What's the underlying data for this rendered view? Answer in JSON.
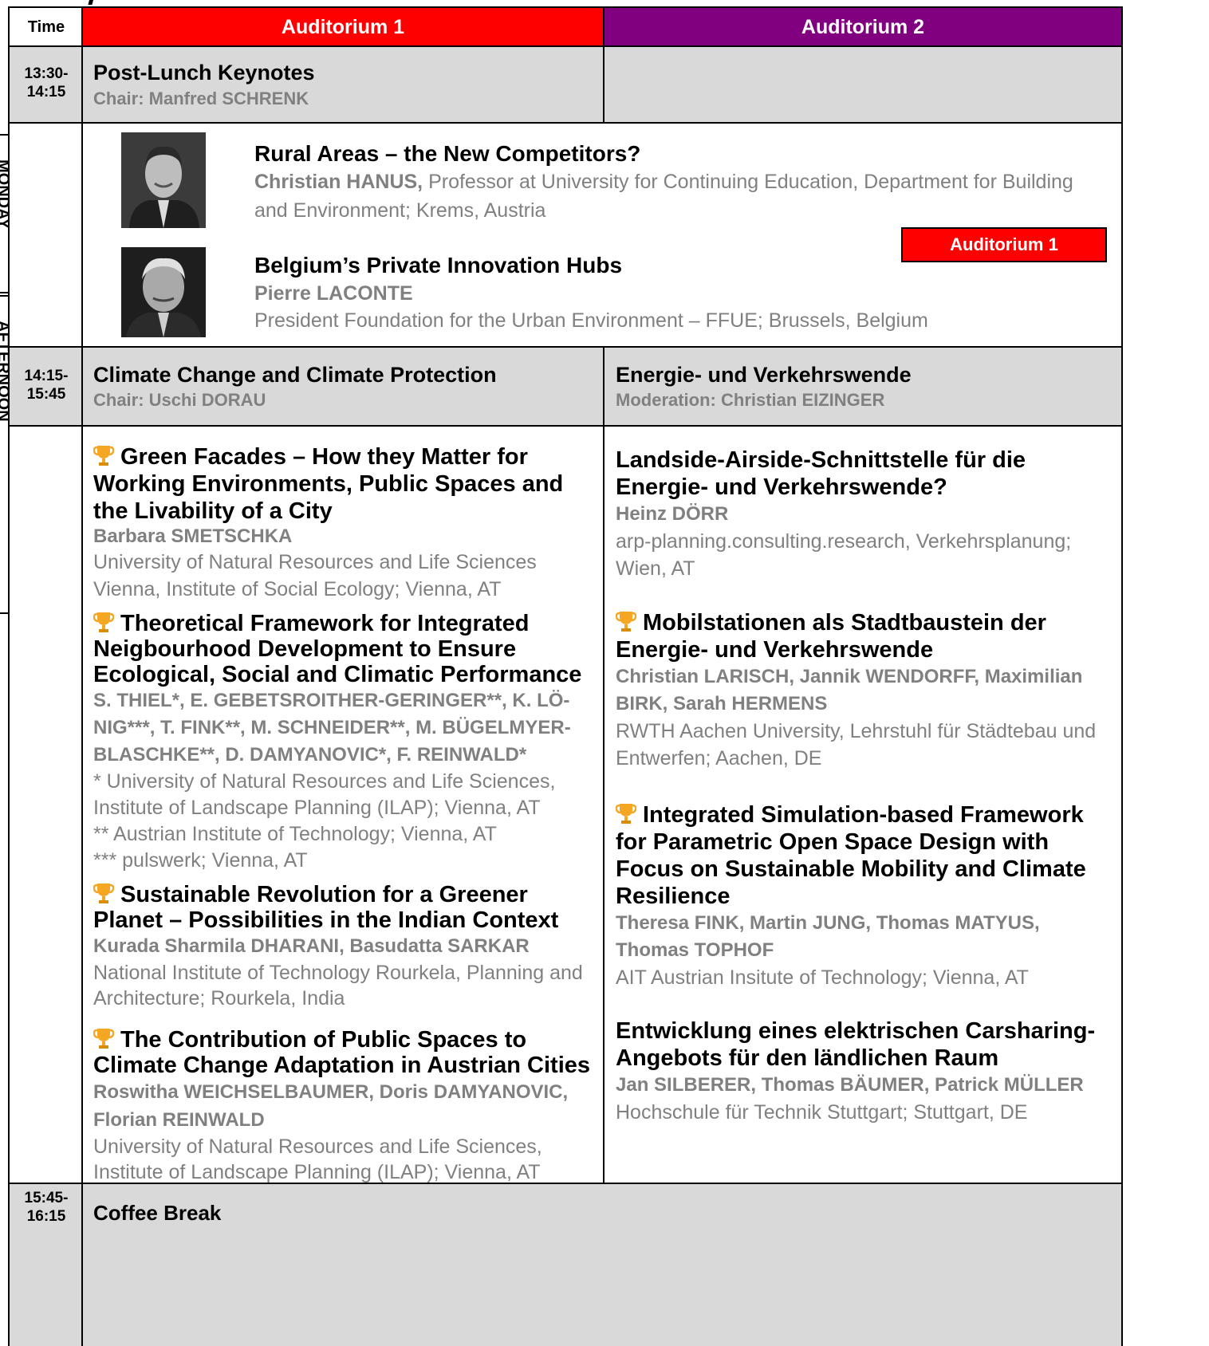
{
  "header": {
    "time": "Time",
    "aud1": "Auditorium 1",
    "aud2": "Auditorium 2"
  },
  "colors": {
    "aud1": "#ff0000",
    "aud2": "#800080",
    "session_bg": "#d9d9d9",
    "secondary_text": "#808080",
    "trophy": "#f5a623"
  },
  "side_tabs": [
    "MONDAY",
    "AFTERNOON"
  ],
  "slot1": {
    "time": "13:30-\n14:15",
    "title": "Post-Lunch Keynotes",
    "chair": "Chair: Manfred SCHRENK",
    "badge": "Auditorium 1",
    "talks": [
      {
        "title": "Rural Areas – the New Competitors?",
        "speaker": "Christian HANUS,",
        "affiliation_inline": " Professor at University for Continuing Education, Department for Building and Environment; Krems, Austria"
      },
      {
        "title": "Belgium’s Private Innovation Hubs",
        "speaker": "Pierre LACONTE",
        "affiliation": "President Foundation for the Urban Environment – FFUE; Brussels, Belgium"
      }
    ]
  },
  "slot2": {
    "time": "14:15-\n15:45",
    "left": {
      "title": "Climate Change and Climate Protection",
      "chair": "Chair: Uschi DORAU"
    },
    "right": {
      "title": "Energie- und Verkehrswende",
      "chair": "Moderation: Christian EIZINGER"
    },
    "left_talks": [
      {
        "title": "Green Facades – How they Matter for Working Environments, Public Spaces and the Livability of a City",
        "authors": "Barbara SMETSCHKA",
        "affiliation": "University of Natural Resources and Life Sciences Vienna, Institute of Social Ecology; Vienna, AT"
      },
      {
        "title": "Theoretical Framework for Integrated Neigbourhood Development to Ensure Ecological, Social and Climatic Performance",
        "authors": "S. THIEL*, E. GEBETSROITHER-GERINGER**, K. LÖ-NIG***, T. FINK**, M. SCHNEIDER**, M. BÜGELMYER-BLASCHKE**, D. DAMYANOVIC*, F. REINWALD*",
        "notes": [
          "* University of Natural Resources and Life Sciences, Institute of Landscape Planning (ILAP); Vienna, AT",
          "** Austrian Institute of Technology; Vienna, AT",
          "*** pulswerk; Vienna, AT"
        ]
      },
      {
        "title": "Sustainable Revolution for a Greener Planet – Possibilities in the Indian Context",
        "authors": "Kurada Sharmila DHARANI, Basudatta SARKAR",
        "affiliation": "National Institute of Technology Rourkela, Planning and Architecture; Rourkela, India"
      },
      {
        "title": "The Contribution of Public Spaces to Climate Change Adaptation in Austrian Cities",
        "authors": "Roswitha WEICHSELBAUMER, Doris DAMYANOVIC, Florian REINWALD",
        "affiliation": "University of Natural Resources and Life Sciences, Institute of Landscape Planning (ILAP); Vienna, AT"
      }
    ],
    "right_talks": [
      {
        "title": "Landside-Airside-Schnittstelle für die Energie- und Verkehrswende?",
        "authors": "Heinz DÖRR",
        "affiliation": "arp-planning.consulting.research, Verkehrsplanung; Wien, AT"
      },
      {
        "title": "Mobilstationen als Stadtbaustein der Energie- und Verkehrswende",
        "authors": "Christian LARISCH, Jannik WENDORFF, Maximilian BIRK, Sarah HERMENS",
        "affiliation": "RWTH Aachen University, Lehrstuhl für Städtebau und Entwerfen; Aachen, DE"
      },
      {
        "title": "Integrated Simulation-based Framework for Parametric Open Space Design with Focus on Sustainable Mobility and Climate Resilience",
        "authors": "Theresa FINK, Martin JUNG, Thomas MATYUS, Thomas TOPHOF",
        "affiliation": "AIT Austrian Insitute of Technology; Vienna, AT"
      },
      {
        "title": "Entwicklung eines elektrischen Carsharing-Angebots für den ländlichen Raum",
        "authors": "Jan SILBERER, Thomas BÄUMER, Patrick MÜLLER",
        "affiliation": "Hochschule für Technik Stuttgart; Stuttgart, DE"
      }
    ]
  },
  "slot3": {
    "time": "15:45-\n16:15",
    "title": "Coffee Break"
  }
}
